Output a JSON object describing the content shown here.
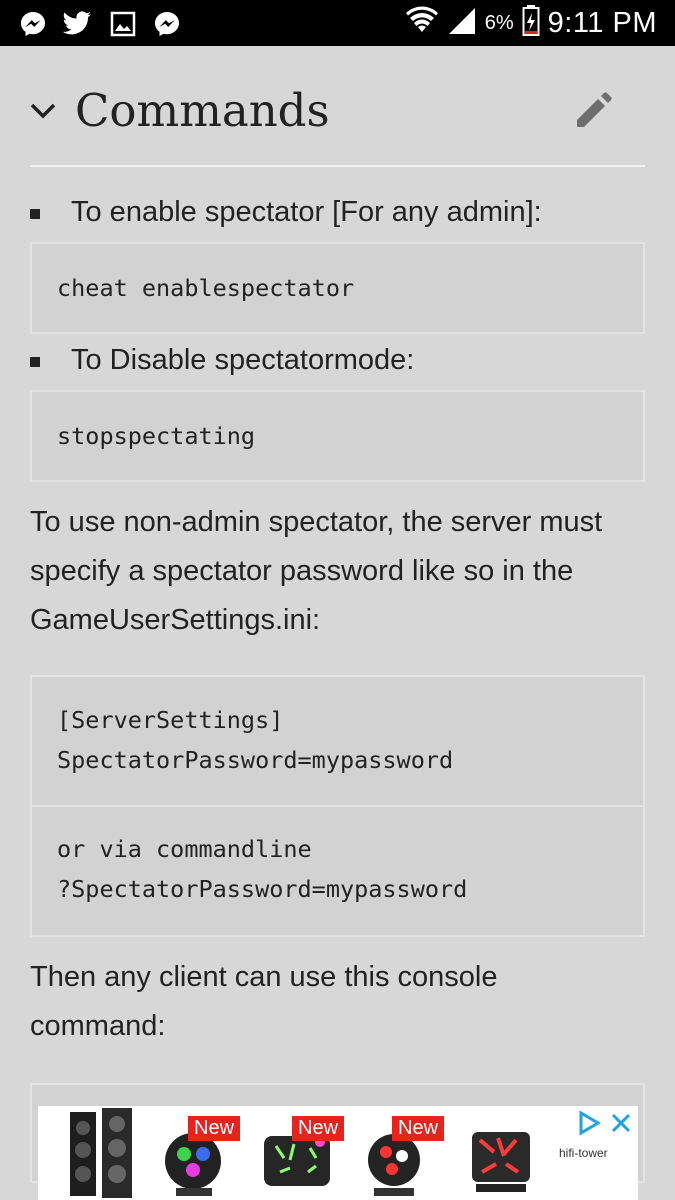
{
  "status_bar": {
    "notification_icons": [
      "messenger-icon",
      "twitter-icon",
      "gallery-icon",
      "messenger-icon"
    ],
    "battery_percent": "6%",
    "time": "9:11 PM"
  },
  "section": {
    "title": "Commands"
  },
  "bullets": [
    {
      "text": "To enable spectator [For any admin]:",
      "code": "cheat enablespectator"
    },
    {
      "text": "To Disable spectatormode:",
      "code": "stopspectating"
    }
  ],
  "paragraph1": {
    "line1": "To use non-admin spectator, the server must",
    "line2": "specify a spectator password like so in the",
    "line3": "GameUserSettings.ini:"
  },
  "code_block1": {
    "line1": "[ServerSettings]",
    "line2": "SpectatorPassword=mypassword"
  },
  "code_block2": {
    "line1": "or via commandline",
    "line2": "?SpectatorPassword=mypassword"
  },
  "paragraph2": {
    "line1": "Then any client can use this console",
    "line2": "command:"
  },
  "ad": {
    "new_label": "New",
    "brand": "hifi-tower"
  }
}
